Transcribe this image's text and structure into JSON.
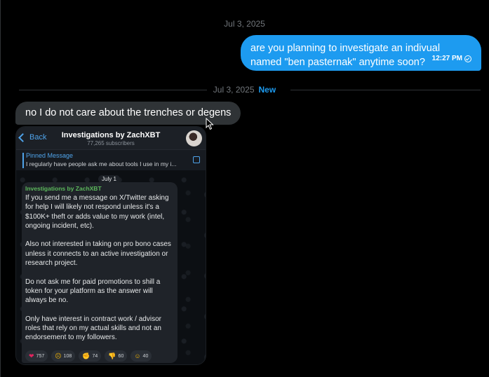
{
  "thread": {
    "first_date": "Jul 3, 2025",
    "second_date": "Jul 3, 2025",
    "new_label": "New"
  },
  "outgoing": {
    "text": "are you planning to investigate an indivual named \"ben pasternak\" anytime soon?",
    "time": "12:27 PM"
  },
  "incoming": {
    "text": "no I do not care about the trenches or degens"
  },
  "attachment": {
    "back_label": "Back",
    "channel_title": "Investigations by ZachXBT",
    "subscribers": "77,265 subscribers",
    "pinned_label": "Pinned Message",
    "pinned_text": "I regularly have people ask me about tools I use in my i...",
    "day_label": "July 1",
    "author": "Investigations by ZachXBT",
    "body": "If you send me a message on X/Twitter asking for help I will likely not respond unless it's a $100K+ theft or adds value to my work (intel, ongoing incident, etc).\n\nAlso not interested in taking on pro bono cases unless it connects to an active investigation or research project.\n\nDo not ask me for paid promotions to shill a token for your platform as the answer will always be no.\n\nOnly have interest in contract work / advisor roles that rely on my actual skills and not an endorsement to my followers.",
    "reactions": [
      {
        "emoji": "❤",
        "icon": "heart-icon",
        "count": "757"
      },
      {
        "emoji": "☹",
        "icon": "sad-face-icon",
        "count": "108"
      },
      {
        "emoji": "✊",
        "icon": "handshake-icon",
        "count": "74"
      },
      {
        "emoji": "👎",
        "icon": "thumbs-down-icon",
        "count": "60"
      },
      {
        "emoji": "☺",
        "icon": "nerd-face-icon",
        "count": "40"
      }
    ]
  },
  "colors": {
    "accent": "#1d9bf0",
    "background": "#000000",
    "incoming_bubble": "#2f3336"
  }
}
